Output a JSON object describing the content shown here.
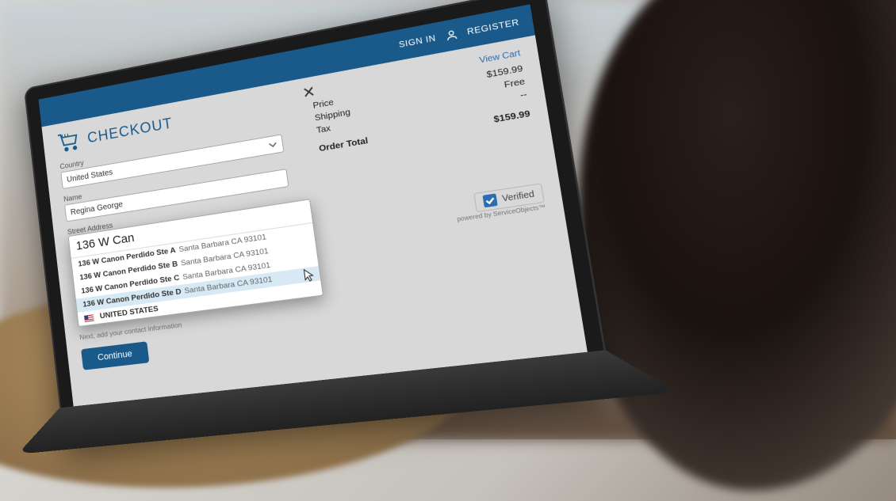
{
  "topbar": {
    "sign_in": "SIGN IN",
    "register": "REGISTER"
  },
  "checkout": {
    "title": "CHECKOUT",
    "country_label": "Country",
    "country_value": "United States",
    "name_label": "Name",
    "name_value": "Regina George",
    "street_label": "Street Address",
    "street_input": "136 W Can",
    "suggestions": [
      {
        "bold": "136 W Canon Perdido Ste A",
        "rest": "Santa Barbara CA 93101"
      },
      {
        "bold": "136 W Canon Perdido Ste B",
        "rest": "Santa Barbara CA 93101"
      },
      {
        "bold": "136 W Canon Perdido Ste C",
        "rest": "Santa Barbara CA 93101"
      },
      {
        "bold": "136 W Canon Perdido Ste D",
        "rest": "Santa Barbara CA 93101"
      }
    ],
    "flag_row": "UNITED STATES",
    "helper": "Next, add your contact information",
    "continue": "Continue"
  },
  "summary": {
    "close": "✕",
    "view_cart": "View Cart",
    "rows": [
      {
        "label": "Price",
        "value": "$159.99"
      },
      {
        "label": "Shipping",
        "value": "Free"
      },
      {
        "label": "Tax",
        "value": "--"
      }
    ],
    "total_label": "Order Total",
    "total_value": "$159.99",
    "verified": "Verified",
    "powered": "powered by ServiceObjects™"
  }
}
